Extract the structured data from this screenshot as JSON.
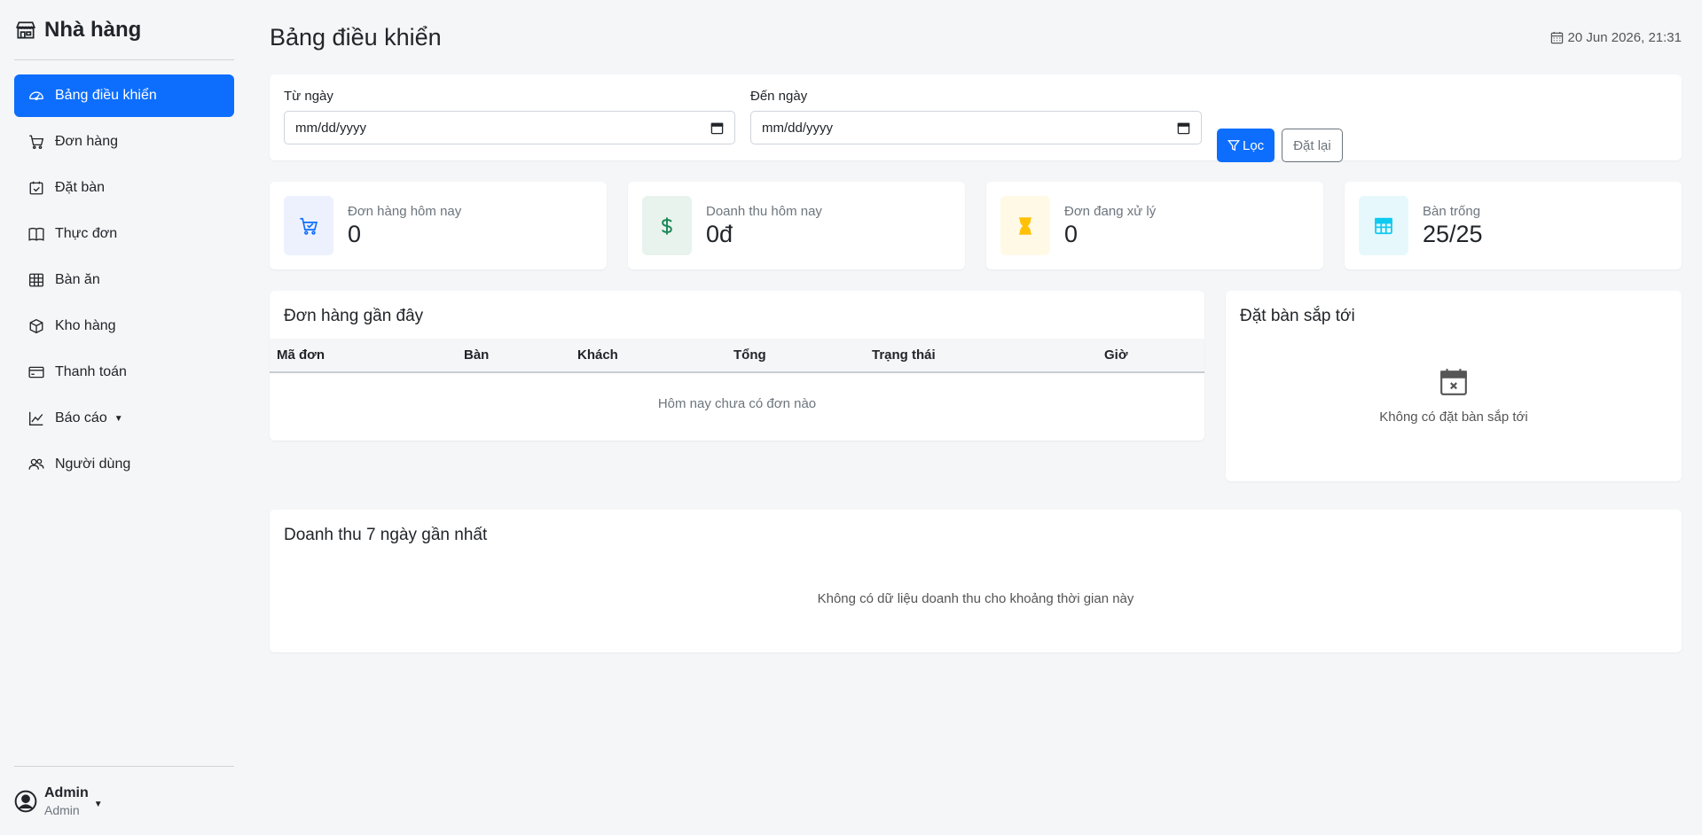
{
  "brand": {
    "name": "Nhà hàng",
    "icon": "store-icon"
  },
  "nav": [
    {
      "label": "Bảng điều khiển",
      "icon": "speedometer-icon",
      "active": true
    },
    {
      "label": "Đơn hàng",
      "icon": "cart-icon"
    },
    {
      "label": "Đặt bàn",
      "icon": "calendar-check-icon"
    },
    {
      "label": "Thực đơn",
      "icon": "book-icon"
    },
    {
      "label": "Bàn ăn",
      "icon": "table-icon"
    },
    {
      "label": "Kho hàng",
      "icon": "box-icon"
    },
    {
      "label": "Thanh toán",
      "icon": "credit-card-icon"
    },
    {
      "label": "Báo cáo",
      "icon": "chart-line-icon",
      "has_caret": true
    },
    {
      "label": "Người dùng",
      "icon": "people-icon"
    }
  ],
  "user": {
    "name": "Admin",
    "role": "Admin"
  },
  "header": {
    "title": "Bảng điều khiển",
    "datetime": "20 Jun 2026, 21:31"
  },
  "filter": {
    "from_label": "Từ ngày",
    "to_label": "Đến ngày",
    "from_value": "mm/dd/yyyy",
    "to_value": "mm/dd/yyyy",
    "filter_button": "Lọc",
    "reset_button": "Đặt lại"
  },
  "stats": [
    {
      "label": "Đơn hàng hôm nay",
      "value": "0",
      "icon": "cart-check-icon",
      "color": "#0d6efd",
      "bg": "#ecf1fd"
    },
    {
      "label": "Doanh thu hôm nay",
      "value": "0đ",
      "icon": "dollar-icon",
      "color": "#198754",
      "bg": "#e8f3ee"
    },
    {
      "label": "Đơn đang xử lý",
      "value": "0",
      "icon": "hourglass-icon",
      "color": "#ffc107",
      "bg": "#fff9e6"
    },
    {
      "label": "Bàn trống",
      "value": "25/25",
      "icon": "table-icon",
      "color": "#0dcaf0",
      "bg": "#e7f8fd"
    }
  ],
  "orders": {
    "title": "Đơn hàng gần đây",
    "columns": [
      "Mã đơn",
      "Bàn",
      "Khách",
      "Tổng",
      "Trạng thái",
      "Giờ"
    ],
    "empty": "Hôm nay chưa có đơn nào"
  },
  "reservations": {
    "title": "Đặt bàn sắp tới",
    "empty": "Không có đặt bàn sắp tới"
  },
  "revenue": {
    "title": "Doanh thu 7 ngày gần nhất",
    "empty": "Không có dữ liệu doanh thu cho khoảng thời gian này"
  },
  "colors": {
    "primary": "#0d6efd",
    "background": "#f5f6f8"
  }
}
